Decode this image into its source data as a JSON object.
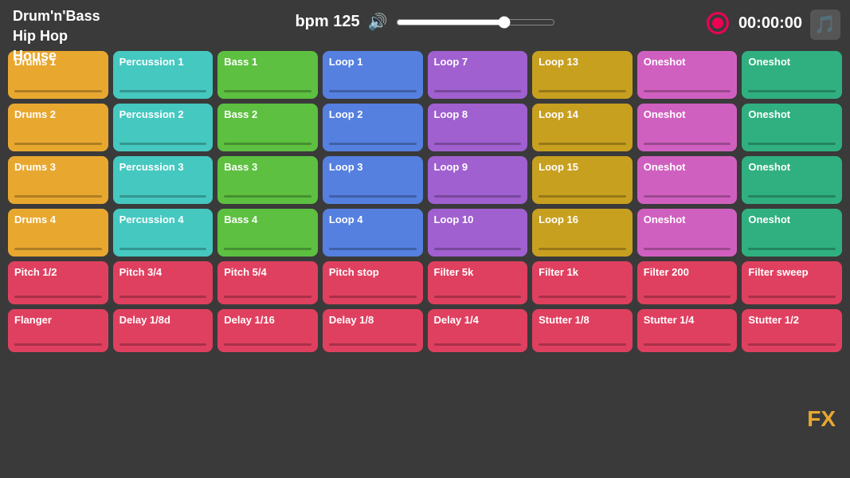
{
  "header": {
    "genres": [
      "Drum'n'Bass",
      "Hip Hop",
      "House"
    ],
    "active_genre": "House",
    "bpm_label": "bpm 125",
    "time_display": "00:00:00",
    "music_icon": "🎵"
  },
  "rows": [
    {
      "id": "row1",
      "pads": [
        {
          "label": "Drums 1",
          "color": "yellow",
          "size": "pad-drums"
        },
        {
          "label": "Percussion 1",
          "color": "cyan",
          "size": "pad-perc"
        },
        {
          "label": "Bass 1",
          "color": "green",
          "size": "pad-bass"
        },
        {
          "label": "Loop 1",
          "color": "blue",
          "size": "pad-loop"
        },
        {
          "label": "Loop 7",
          "color": "purple",
          "size": "pad-loop2"
        },
        {
          "label": "Loop 13",
          "color": "gold",
          "size": "pad-loop3"
        },
        {
          "label": "Oneshot",
          "color": "magenta",
          "size": "pad-oneshot"
        },
        {
          "label": "Oneshot",
          "color": "teal",
          "size": "pad-oneshot"
        }
      ]
    },
    {
      "id": "row2",
      "pads": [
        {
          "label": "Drums 2",
          "color": "yellow",
          "size": "pad-drums"
        },
        {
          "label": "Percussion 2",
          "color": "cyan",
          "size": "pad-perc"
        },
        {
          "label": "Bass 2",
          "color": "green",
          "size": "pad-bass"
        },
        {
          "label": "Loop 2",
          "color": "blue",
          "size": "pad-loop"
        },
        {
          "label": "Loop 8",
          "color": "purple",
          "size": "pad-loop2"
        },
        {
          "label": "Loop 14",
          "color": "gold",
          "size": "pad-loop3"
        },
        {
          "label": "Oneshot",
          "color": "magenta",
          "size": "pad-oneshot"
        },
        {
          "label": "Oneshot",
          "color": "teal",
          "size": "pad-oneshot"
        }
      ]
    },
    {
      "id": "row3",
      "pads": [
        {
          "label": "Drums 3",
          "color": "yellow",
          "size": "pad-drums"
        },
        {
          "label": "Percussion 3",
          "color": "cyan",
          "size": "pad-perc"
        },
        {
          "label": "Bass 3",
          "color": "green",
          "size": "pad-bass"
        },
        {
          "label": "Loop 3",
          "color": "blue",
          "size": "pad-loop"
        },
        {
          "label": "Loop 9",
          "color": "purple",
          "size": "pad-loop2"
        },
        {
          "label": "Loop 15",
          "color": "gold",
          "size": "pad-loop3"
        },
        {
          "label": "Oneshot",
          "color": "magenta",
          "size": "pad-oneshot"
        },
        {
          "label": "Oneshot",
          "color": "teal",
          "size": "pad-oneshot"
        }
      ]
    },
    {
      "id": "row4",
      "pads": [
        {
          "label": "Drums 4",
          "color": "yellow",
          "size": "pad-drums"
        },
        {
          "label": "Percussion 4",
          "color": "cyan",
          "size": "pad-perc"
        },
        {
          "label": "Bass 4",
          "color": "green",
          "size": "pad-bass"
        },
        {
          "label": "Loop 4",
          "color": "blue",
          "size": "pad-loop"
        },
        {
          "label": "Loop 10",
          "color": "purple",
          "size": "pad-loop2"
        },
        {
          "label": "Loop 16",
          "color": "gold",
          "size": "pad-loop3"
        },
        {
          "label": "Oneshot",
          "color": "magenta",
          "size": "pad-oneshot"
        },
        {
          "label": "Oneshot",
          "color": "teal",
          "size": "pad-oneshot"
        }
      ]
    },
    {
      "id": "row5",
      "pads": [
        {
          "label": "Pitch 1/2",
          "color": "pink-fx",
          "size": "pad-fx"
        },
        {
          "label": "Pitch 3/4",
          "color": "pink-fx",
          "size": "pad-fx"
        },
        {
          "label": "Pitch 5/4",
          "color": "pink-fx",
          "size": "pad-fx"
        },
        {
          "label": "Pitch stop",
          "color": "pink-fx",
          "size": "pad-fx"
        },
        {
          "label": "Filter 5k",
          "color": "pink-fx",
          "size": "pad-fx"
        },
        {
          "label": "Filter 1k",
          "color": "pink-fx",
          "size": "pad-fx"
        },
        {
          "label": "Filter 200",
          "color": "pink-fx",
          "size": "pad-fx"
        },
        {
          "label": "Filter sweep",
          "color": "pink-fx",
          "size": "pad-fx"
        }
      ]
    },
    {
      "id": "row6",
      "pads": [
        {
          "label": "Flanger",
          "color": "red-fx",
          "size": "pad-fx"
        },
        {
          "label": "Delay 1/8d",
          "color": "red-fx",
          "size": "pad-fx"
        },
        {
          "label": "Delay 1/16",
          "color": "red-fx",
          "size": "pad-fx"
        },
        {
          "label": "Delay 1/8",
          "color": "red-fx",
          "size": "pad-fx"
        },
        {
          "label": "Delay 1/4",
          "color": "red-fx",
          "size": "pad-fx"
        },
        {
          "label": "Stutter 1/8",
          "color": "red-fx",
          "size": "pad-fx"
        },
        {
          "label": "Stutter 1/4",
          "color": "red-fx",
          "size": "pad-fx"
        },
        {
          "label": "Stutter 1/2",
          "color": "red-fx",
          "size": "pad-fx"
        }
      ]
    }
  ],
  "fx_label": "FX"
}
